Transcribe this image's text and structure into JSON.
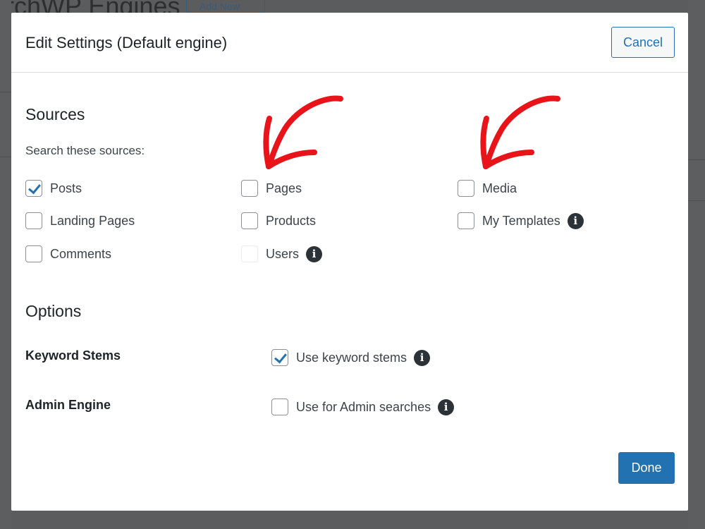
{
  "background": {
    "page_title_fragment": "archWP Engines",
    "add_new_fragment": "Add New"
  },
  "modal": {
    "title": "Edit Settings (Default engine)",
    "cancel_label": "Cancel",
    "done_label": "Done"
  },
  "sources": {
    "heading": "Sources",
    "subtext": "Search these sources:",
    "items": [
      {
        "label": "Posts",
        "checked": true
      },
      {
        "label": "Pages",
        "checked": false
      },
      {
        "label": "Media",
        "checked": false
      },
      {
        "label": "Landing Pages",
        "checked": false
      },
      {
        "label": "Products",
        "checked": false
      },
      {
        "label": "My Templates",
        "checked": false,
        "info": true
      },
      {
        "label": "Comments",
        "checked": false
      },
      {
        "label": "Users",
        "checked": false,
        "info": true,
        "disabled": true
      }
    ]
  },
  "options": {
    "heading": "Options",
    "keyword_stems": {
      "label": "Keyword Stems",
      "control_label": "Use keyword stems",
      "checked": true
    },
    "admin_engine": {
      "label": "Admin Engine",
      "control_label": "Use for Admin searches",
      "checked": false
    }
  },
  "annotations": {
    "arrow_color": "#e8141a"
  }
}
